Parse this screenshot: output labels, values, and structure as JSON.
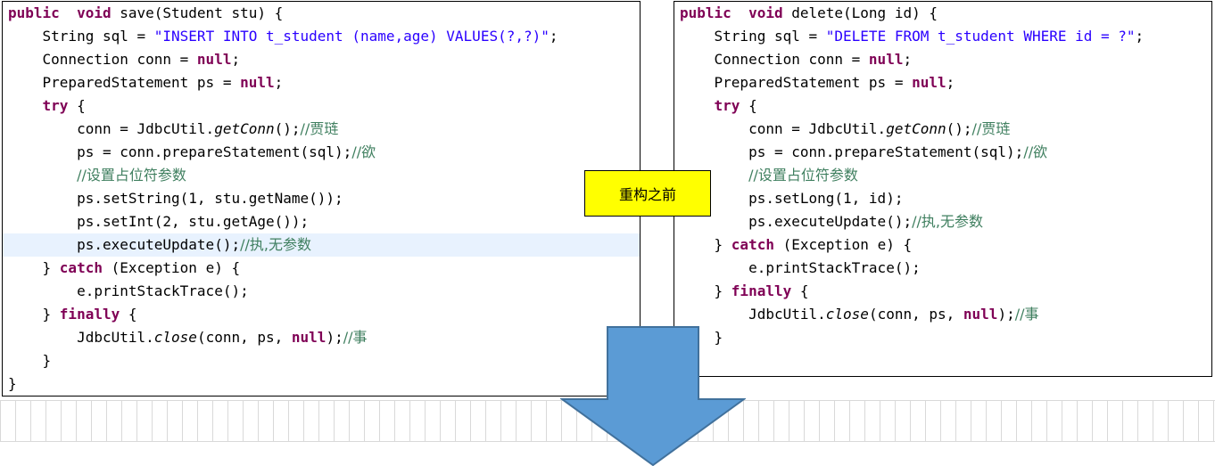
{
  "label": {
    "text": "重构之前",
    "color": "#ffff00"
  },
  "arrow": {
    "icon": "down-arrow-icon",
    "fill": "#5b9bd5",
    "stroke": "#41719c"
  },
  "colors": {
    "keyword": "#7f0055",
    "string": "#2a00ff",
    "comment": "#3f7f5f",
    "highlight": "#e8f2fe"
  },
  "left_panel": {
    "lines": [
      [
        [
          "kw",
          "public"
        ],
        [
          "",
          "  "
        ],
        [
          "kw",
          "void"
        ],
        [
          "",
          " save(Student stu) {"
        ]
      ],
      [
        [
          "",
          "    String sql = "
        ],
        [
          "str",
          "\"INSERT INTO t_student (name,age) VALUES(?,?)\""
        ],
        [
          "",
          ";"
        ]
      ],
      [
        [
          "",
          "    Connection conn = "
        ],
        [
          "kw",
          "null"
        ],
        [
          "",
          ";"
        ]
      ],
      [
        [
          "",
          "    PreparedStatement ps = "
        ],
        [
          "kw",
          "null"
        ],
        [
          "",
          ";"
        ]
      ],
      [
        [
          "",
          "    "
        ],
        [
          "kw",
          "try"
        ],
        [
          "",
          " {"
        ]
      ],
      [
        [
          "",
          "        conn = JdbcUtil."
        ],
        [
          "it",
          "getConn"
        ],
        [
          "",
          "();"
        ],
        [
          "cm",
          "//贾琏"
        ]
      ],
      [
        [
          "",
          "        ps = conn.prepareStatement(sql);"
        ],
        [
          "cm",
          "//欲"
        ]
      ],
      [
        [
          "",
          "        "
        ],
        [
          "cm",
          "//设置占位符参数"
        ]
      ],
      [
        [
          "",
          "        ps.setString(1, stu.getName());"
        ]
      ],
      [
        [
          "",
          "        ps.setInt(2, stu.getAge());"
        ]
      ],
      [
        [
          "",
          "        ps.executeUpdate();"
        ],
        [
          "cm",
          "//执,无参数"
        ]
      ],
      [
        [
          "",
          "    } "
        ],
        [
          "kw",
          "catch"
        ],
        [
          "",
          " (Exception e) {"
        ]
      ],
      [
        [
          "",
          "        e.printStackTrace();"
        ]
      ],
      [
        [
          "",
          "    } "
        ],
        [
          "kw",
          "finally"
        ],
        [
          "",
          " {"
        ]
      ],
      [
        [
          "",
          "        JdbcUtil."
        ],
        [
          "it",
          "close"
        ],
        [
          "",
          "(conn, ps, "
        ],
        [
          "kw",
          "null"
        ],
        [
          "",
          ");"
        ],
        [
          "cm",
          "//事"
        ]
      ],
      [
        [
          "",
          "    }"
        ]
      ],
      [
        [
          "",
          "}"
        ]
      ]
    ],
    "highlight_line": 10
  },
  "right_panel": {
    "lines": [
      [
        [
          "kw",
          "public"
        ],
        [
          "",
          "  "
        ],
        [
          "kw",
          "void"
        ],
        [
          "",
          " delete(Long id) {"
        ]
      ],
      [
        [
          "",
          "    String sql = "
        ],
        [
          "str",
          "\"DELETE FROM t_student WHERE id = ?\""
        ],
        [
          "",
          ";"
        ]
      ],
      [
        [
          "",
          "    Connection conn = "
        ],
        [
          "kw",
          "null"
        ],
        [
          "",
          ";"
        ]
      ],
      [
        [
          "",
          "    PreparedStatement ps = "
        ],
        [
          "kw",
          "null"
        ],
        [
          "",
          ";"
        ]
      ],
      [
        [
          "",
          "    "
        ],
        [
          "kw",
          "try"
        ],
        [
          "",
          " {"
        ]
      ],
      [
        [
          "",
          "        conn = JdbcUtil."
        ],
        [
          "it",
          "getConn"
        ],
        [
          "",
          "();"
        ],
        [
          "cm",
          "//贾琏"
        ]
      ],
      [
        [
          "",
          "        ps = conn.prepareStatement(sql);"
        ],
        [
          "cm",
          "//欲"
        ]
      ],
      [
        [
          "",
          "        "
        ],
        [
          "cm",
          "//设置占位符参数"
        ]
      ],
      [
        [
          "",
          "        ps.setLong(1, id);"
        ]
      ],
      [
        [
          "",
          "        ps.executeUpdate();"
        ],
        [
          "cm",
          "//执,无参数"
        ]
      ],
      [
        [
          "",
          "    } "
        ],
        [
          "kw",
          "catch"
        ],
        [
          "",
          " (Exception e) {"
        ]
      ],
      [
        [
          "",
          "        e.printStackTrace();"
        ]
      ],
      [
        [
          "",
          "    } "
        ],
        [
          "kw",
          "finally"
        ],
        [
          "",
          " {"
        ]
      ],
      [
        [
          "",
          "        JdbcUtil."
        ],
        [
          "it",
          "close"
        ],
        [
          "",
          "(conn, ps, "
        ],
        [
          "kw",
          "null"
        ],
        [
          "",
          ");"
        ],
        [
          "cm",
          "//事"
        ]
      ],
      [
        [
          "",
          "    }"
        ]
      ]
    ],
    "highlight_line": -1
  }
}
